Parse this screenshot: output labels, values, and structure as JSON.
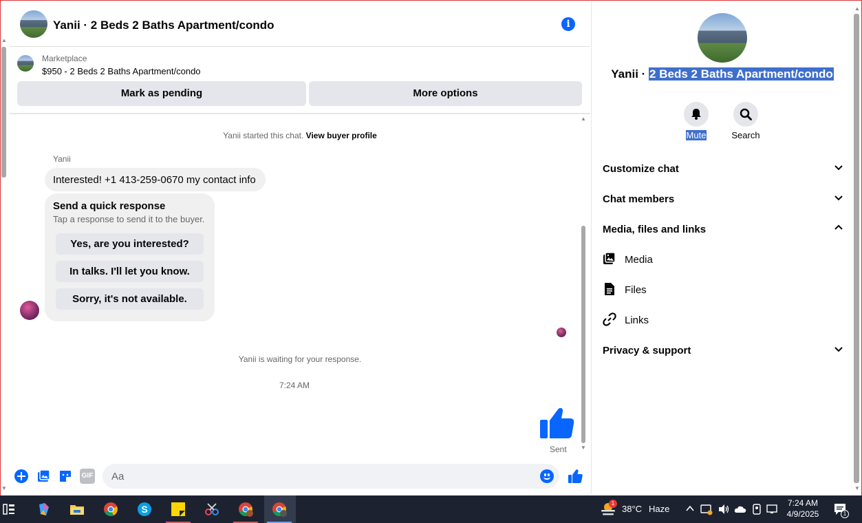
{
  "chat": {
    "header_title": "Yanii · 2 Beds 2 Baths Apartment/condo",
    "marketplace_label": "Marketplace",
    "listing_line": "$950 - 2 Beds 2 Baths Apartment/condo",
    "mark_pending_label": "Mark as pending",
    "more_options_label": "More options",
    "started_text": "Yanii started this chat.",
    "view_profile_link": "View buyer profile",
    "sender_name": "Yanii",
    "message_text": "Interested! +1 413-259-0670 my contact info",
    "quick_response": {
      "title": "Send a quick response",
      "subtitle": "Tap a response to send it to the buyer.",
      "options": [
        "Yes, are you interested?",
        "In talks. I'll let you know.",
        "Sorry, it's not available."
      ]
    },
    "waiting_text": "Yanii is waiting for your response.",
    "timestamp": "7:24 AM",
    "sent_label": "Sent",
    "composer_placeholder": "Aa",
    "composer_gif_label": "GIF"
  },
  "panel": {
    "title_prefix": "Yanii · ",
    "title_highlight": "2 Beds 2 Baths Apartment/condo",
    "mute_label": "Mute",
    "search_label": "Search",
    "menu": [
      {
        "label": "Customize chat",
        "expanded": false
      },
      {
        "label": "Chat members",
        "expanded": false
      },
      {
        "label": "Media, files and links",
        "expanded": true
      },
      {
        "label": "Privacy & support",
        "expanded": false
      }
    ],
    "sub_items": [
      "Media",
      "Files",
      "Links"
    ]
  },
  "taskbar": {
    "weather_temp": "38°C",
    "weather_desc": "Haze",
    "weather_badge": "1",
    "clock_time": "7:24 AM",
    "clock_date": "4/9/2025",
    "notification_count": "1"
  },
  "colors": {
    "accent": "#0866ff",
    "highlight": "#3f6fcc",
    "taskbar": "#1c2230"
  }
}
